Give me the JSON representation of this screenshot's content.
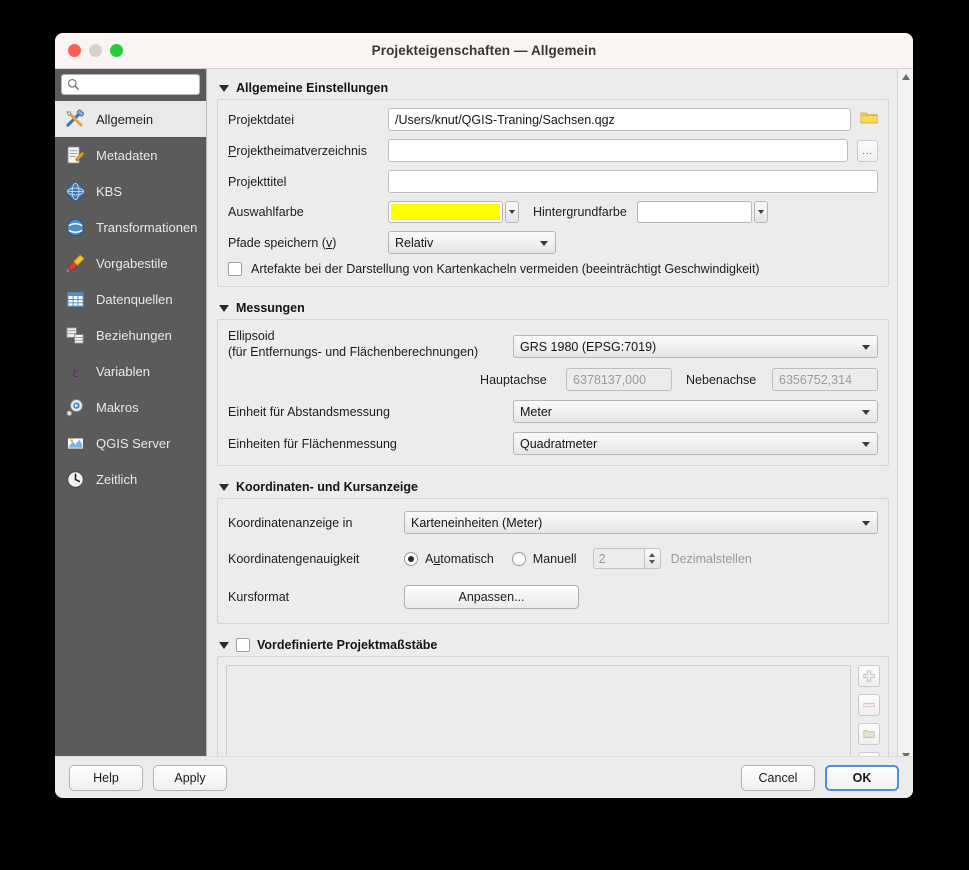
{
  "window": {
    "title": "Projekteigenschaften — Allgemein",
    "traffic": {
      "close": "close-button",
      "minimize": "minimize-button",
      "zoom": "zoom-button"
    }
  },
  "sidebar": {
    "search_placeholder": "",
    "search_value": "",
    "items": [
      {
        "label": "Allgemein",
        "icon": "tools-icon",
        "active": true
      },
      {
        "label": "Metadaten",
        "icon": "document-edit-icon",
        "active": false
      },
      {
        "label": "KBS",
        "icon": "globe-icon",
        "active": false
      },
      {
        "label": "Transformationen",
        "icon": "globe-transform-icon",
        "active": false
      },
      {
        "label": "Vorgabestile",
        "icon": "paintbrush-icon",
        "active": false
      },
      {
        "label": "Datenquellen",
        "icon": "table-icon",
        "active": false
      },
      {
        "label": "Beziehungen",
        "icon": "relations-icon",
        "active": false
      },
      {
        "label": "Variablen",
        "icon": "epsilon-icon",
        "active": false
      },
      {
        "label": "Makros",
        "icon": "gear-play-icon",
        "active": false
      },
      {
        "label": "QGIS Server",
        "icon": "server-map-icon",
        "active": false
      },
      {
        "label": "Zeitlich",
        "icon": "clock-icon",
        "active": false
      }
    ]
  },
  "sections": {
    "general": {
      "title": "Allgemeine Einstellungen",
      "project_file_label": "Projektdatei",
      "project_file_value": "/Users/knut/QGIS-Traning/Sachsen.qgz",
      "project_home_label": "Projektheimatverzeichnis",
      "project_home_value": "",
      "project_title_label": "Projekttitel",
      "project_title_value": "",
      "selection_color_label": "Auswahlfarbe",
      "selection_color_value": "#ffff00",
      "background_color_label": "Hintergrundfarbe",
      "background_color_value": "#ffffff",
      "save_paths_label": "Pfade speichern (v)",
      "save_paths_value": "Relativ",
      "avoid_artifacts_label": "Artefakte bei der Darstellung von Kartenkacheln vermeiden (beeinträchtigt Geschwindigkeit)",
      "avoid_artifacts_checked": false,
      "browse_icon": "folder-icon",
      "ellipsis_label": "..."
    },
    "measurements": {
      "title": "Messungen",
      "ellipsoid_label_line1": "Ellipsoid",
      "ellipsoid_label_line2": "(für Entfernungs- und Flächenberechnungen)",
      "ellipsoid_value": "GRS 1980 (EPSG:7019)",
      "semi_major_label": "Hauptachse",
      "semi_major_value": "6378137,000",
      "semi_minor_label": "Nebenachse",
      "semi_minor_value": "6356752,314",
      "distance_units_label": "Einheit für Abstandsmessung",
      "distance_units_value": "Meter",
      "area_units_label": "Einheiten  für Flächenmessung",
      "area_units_value": "Quadratmeter"
    },
    "coordinates": {
      "title": "Koordinaten- und Kursanzeige",
      "display_label": "Koordinatenanzeige in",
      "display_value": "Karteneinheiten (Meter)",
      "precision_label": "Koordinatengenauigkeit",
      "automatic_label": "Automatisch",
      "manual_label": "Manuell",
      "automatic_selected": true,
      "decimals_value": "2",
      "decimals_label": "Dezimalstellen",
      "cursor_format_label": "Kursformat",
      "customize_button": "Anpassen..."
    },
    "scales": {
      "title": "Vordefinierte Projektmaßstäbe",
      "enabled": false,
      "items": [],
      "buttons": [
        {
          "name": "add-scale-button",
          "icon": "plus-icon"
        },
        {
          "name": "remove-scale-button",
          "icon": "minus-icon"
        },
        {
          "name": "open-scales-button",
          "icon": "folder-open-icon"
        },
        {
          "name": "save-scales-button",
          "icon": "save-icon"
        }
      ]
    }
  },
  "footer": {
    "help": "Help",
    "apply": "Apply",
    "cancel": "Cancel",
    "ok": "OK"
  },
  "colors": {
    "sidebar_bg": "#5b5b5b",
    "titlebar_bg": "#faf5f3",
    "dialog_bg": "#ececec",
    "accent_blue": "#4a90e2",
    "selection_yellow": "#ffff00"
  }
}
